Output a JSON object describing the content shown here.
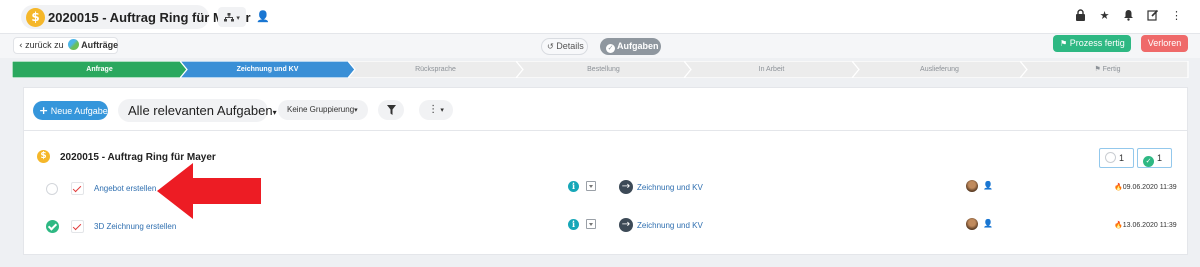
{
  "header": {
    "currency_icon": "dollar-icon",
    "title": "2020015 - Auftrag Ring für Mayer",
    "hierarchy_icon": "sitemap-icon",
    "right_icons": [
      "lock-icon",
      "star-icon",
      "bell-icon",
      "edit-icon",
      "more-vertical-icon"
    ]
  },
  "subbar": {
    "back_prefix": "zurück zu",
    "back_target": "Aufträge",
    "tab_details": "Details",
    "tab_tasks": "Aufgaben",
    "prozess_button": "Prozess fertig",
    "verloren_button": "Verloren"
  },
  "process": {
    "steps": [
      {
        "label": "Anfrage",
        "state": "done"
      },
      {
        "label": "Zeichnung und KV",
        "state": "active"
      },
      {
        "label": "Rücksprache",
        "state": "todo"
      },
      {
        "label": "Bestellung",
        "state": "todo"
      },
      {
        "label": "In Arbeit",
        "state": "todo"
      },
      {
        "label": "Auslieferung",
        "state": "todo"
      },
      {
        "label": "Fertig",
        "state": "todo"
      }
    ],
    "colors": {
      "done": "#2aa85e",
      "active": "#3a8fd6",
      "todo": "#ececec"
    }
  },
  "toolbar": {
    "new_task": "Neue Aufgabe",
    "filter": "Alle relevanten Aufgaben",
    "grouping": "Keine Gruppierung"
  },
  "group": {
    "title": "2020015 - Auftrag Ring für Mayer",
    "open_count": "1",
    "done_count": "1"
  },
  "tasks": [
    {
      "name": "Angebot erstellen",
      "done": false,
      "phase": "Zeichnung und KV",
      "due": "09.06.2020 11:39"
    },
    {
      "name": "3D Zeichnung erstellen",
      "done": true,
      "phase": "Zeichnung und KV",
      "due": "13.06.2020 11:39"
    }
  ]
}
